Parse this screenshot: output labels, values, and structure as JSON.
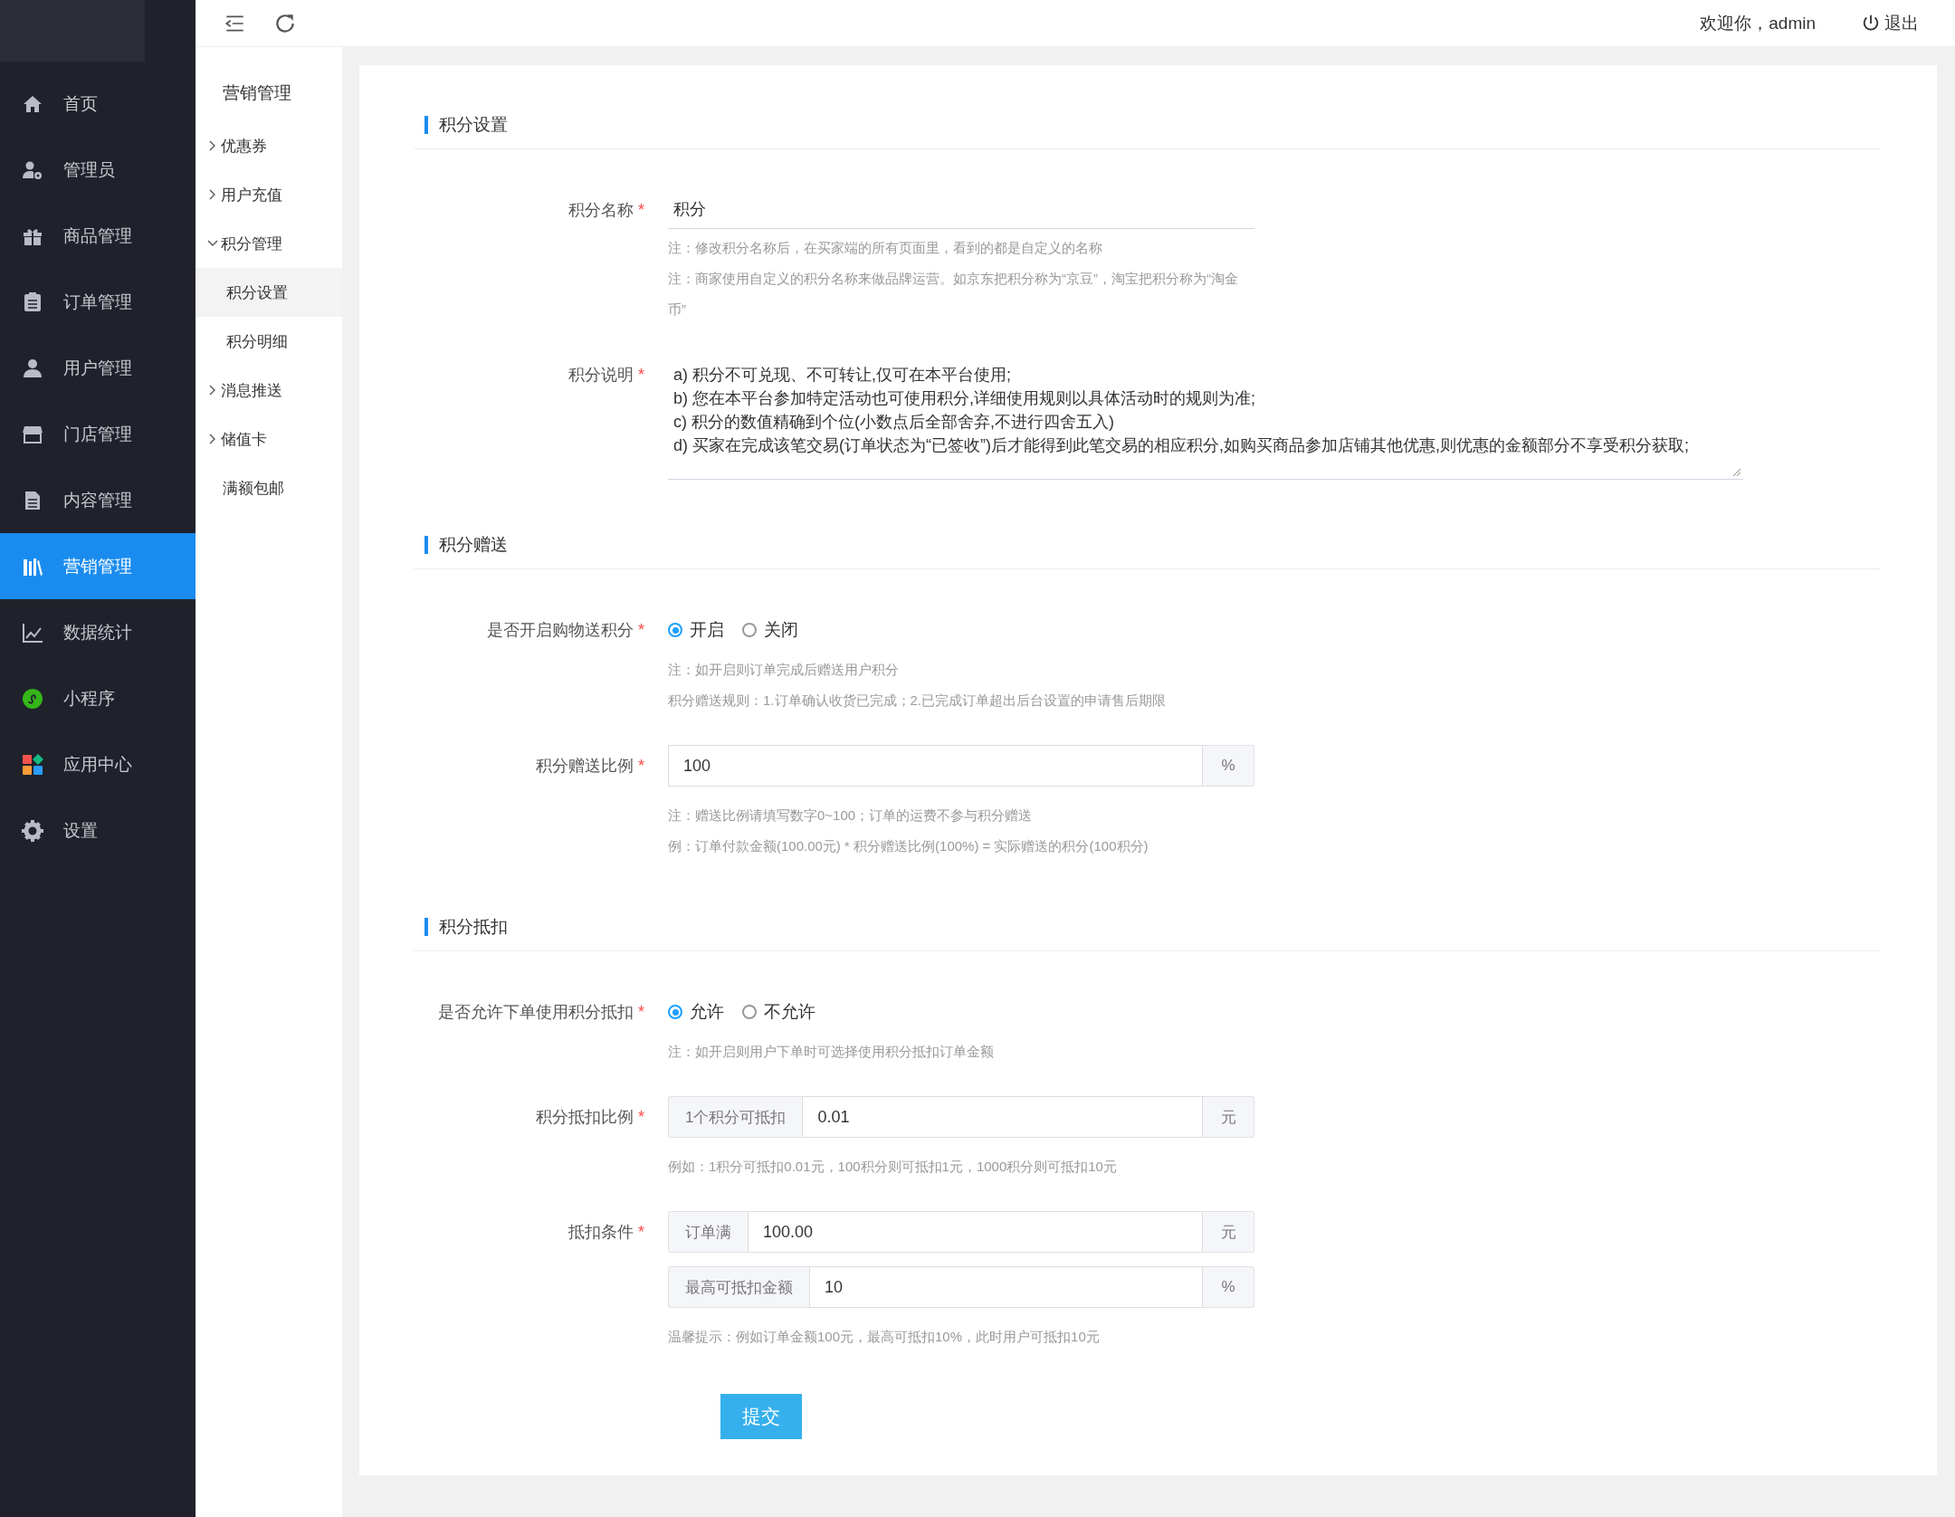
{
  "sidebar": {
    "items": [
      {
        "label": "首页",
        "selected": false
      },
      {
        "label": "管理员",
        "selected": false
      },
      {
        "label": "商品管理",
        "selected": false
      },
      {
        "label": "订单管理",
        "selected": false
      },
      {
        "label": "用户管理",
        "selected": false
      },
      {
        "label": "门店管理",
        "selected": false
      },
      {
        "label": "内容管理",
        "selected": false
      },
      {
        "label": "营销管理",
        "selected": true
      },
      {
        "label": "数据统计",
        "selected": false
      },
      {
        "label": "小程序",
        "selected": false
      },
      {
        "label": "应用中心",
        "selected": false
      },
      {
        "label": "设置",
        "selected": false
      }
    ]
  },
  "submenu": {
    "title": "营销管理",
    "items": [
      {
        "kind": "group",
        "label": "优惠券",
        "expanded": false
      },
      {
        "kind": "group",
        "label": "用户充值",
        "expanded": false
      },
      {
        "kind": "group",
        "label": "积分管理",
        "expanded": true,
        "children": [
          {
            "label": "积分设置",
            "selected": true
          },
          {
            "label": "积分明细",
            "selected": false
          }
        ]
      },
      {
        "kind": "group",
        "label": "消息推送",
        "expanded": false
      },
      {
        "kind": "group",
        "label": "储值卡",
        "expanded": false
      },
      {
        "kind": "link",
        "label": "满额包邮"
      }
    ]
  },
  "header": {
    "welcome": "欢迎你，admin",
    "logout": "退出"
  },
  "sections": [
    {
      "title": "积分设置",
      "fields": [
        {
          "kind": "underline",
          "label": "积分名称",
          "required_mark": "*",
          "value": "积分",
          "notes": [
            "注：修改积分名称后，在买家端的所有页面里，看到的都是自定义的名称",
            "注：商家使用自定义的积分名称来做品牌运营。如京东把积分称为“京豆”，淘宝把积分称为“淘金币”"
          ]
        },
        {
          "kind": "textarea",
          "label": "积分说明",
          "required_mark": "*",
          "lines": [
            "a) 积分不可兑现、不可转让,仅可在本平台使用;",
            "b) 您在本平台参加特定活动也可使用积分,详细使用规则以具体活动时的规则为准;",
            "c) 积分的数值精确到个位(小数点后全部舍弃,不进行四舍五入)",
            "d) 买家在完成该笔交易(订单状态为“已签收”)后才能得到此笔交易的相应积分,如购买商品参加店铺其他优惠,则优惠的金额部分不享受积分获取;"
          ]
        }
      ]
    },
    {
      "title": "积分赠送",
      "fields": [
        {
          "kind": "radio",
          "label": "是否开启购物送积分",
          "required_mark": "*",
          "options": [
            {
              "label": "开启",
              "selected": true
            },
            {
              "label": "关闭",
              "selected": false
            }
          ],
          "notes": [
            "注：如开启则订单完成后赠送用户积分",
            "积分赠送规则：1.订单确认收货已完成；2.已完成订单超出后台设置的申请售后期限"
          ]
        },
        {
          "kind": "group",
          "label": "积分赠送比例",
          "required_mark": "*",
          "rows": [
            {
              "value": "100",
              "suffix": "%"
            }
          ],
          "notes": [
            "注：赠送比例请填写数字0~100；订单的运费不参与积分赠送",
            "例：订单付款金额(100.00元) * 积分赠送比例(100%) = 实际赠送的积分(100积分)"
          ]
        }
      ]
    },
    {
      "title": "积分抵扣",
      "fields": [
        {
          "kind": "radio",
          "label": "是否允许下单使用积分抵扣",
          "required_mark": "*",
          "options": [
            {
              "label": "允许",
              "selected": true
            },
            {
              "label": "不允许",
              "selected": false
            }
          ],
          "notes": [
            "注：如开启则用户下单时可选择使用积分抵扣订单金额"
          ]
        },
        {
          "kind": "group",
          "label": "积分抵扣比例",
          "required_mark": "*",
          "rows": [
            {
              "prefix": "1个积分可抵扣",
              "value": "0.01",
              "suffix": "元"
            }
          ],
          "notes": [
            "例如：1积分可抵扣0.01元，100积分则可抵扣1元，1000积分则可抵扣10元"
          ]
        },
        {
          "kind": "group",
          "label": "抵扣条件",
          "required_mark": "*",
          "rows": [
            {
              "prefix": "订单满",
              "value": "100.00",
              "suffix": "元"
            },
            {
              "prefix": "最高可抵扣金额",
              "value": "10",
              "suffix": "%"
            }
          ],
          "notes": [
            "温馨提示：例如订单金额100元，最高可抵扣10%，此时用户可抵扣10元"
          ]
        }
      ]
    }
  ],
  "submit": "提交"
}
